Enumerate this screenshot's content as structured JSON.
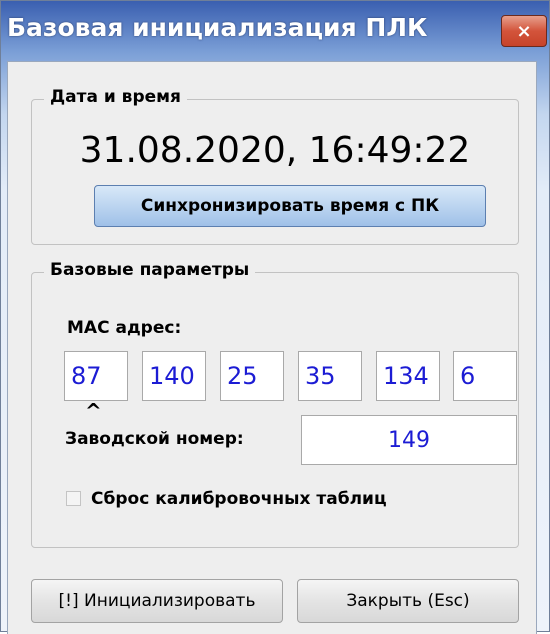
{
  "window": {
    "title": "Базовая инициализация ПЛК",
    "close_label": "×"
  },
  "datetime_group": {
    "legend": "Дата и время",
    "value": "31.08.2020, 16:49:22",
    "sync_label": "Синхронизировать время с ПК"
  },
  "params_group": {
    "legend": "Базовые параметры",
    "mac_label": "MAC адрес:",
    "mac_octets": [
      "87",
      "140",
      "25",
      "35",
      "134",
      "6"
    ],
    "caret": "^",
    "serial_label": "Заводской номер:",
    "serial_value": "149",
    "reset_label": "Сброс калибровочных таблиц",
    "reset_checked": false
  },
  "footer": {
    "init_label": "[!] Инициализировать",
    "close_label": "Закрыть (Esc)"
  },
  "colors": {
    "value_text": "#1c1cd4",
    "close_button": "#d3543b"
  }
}
